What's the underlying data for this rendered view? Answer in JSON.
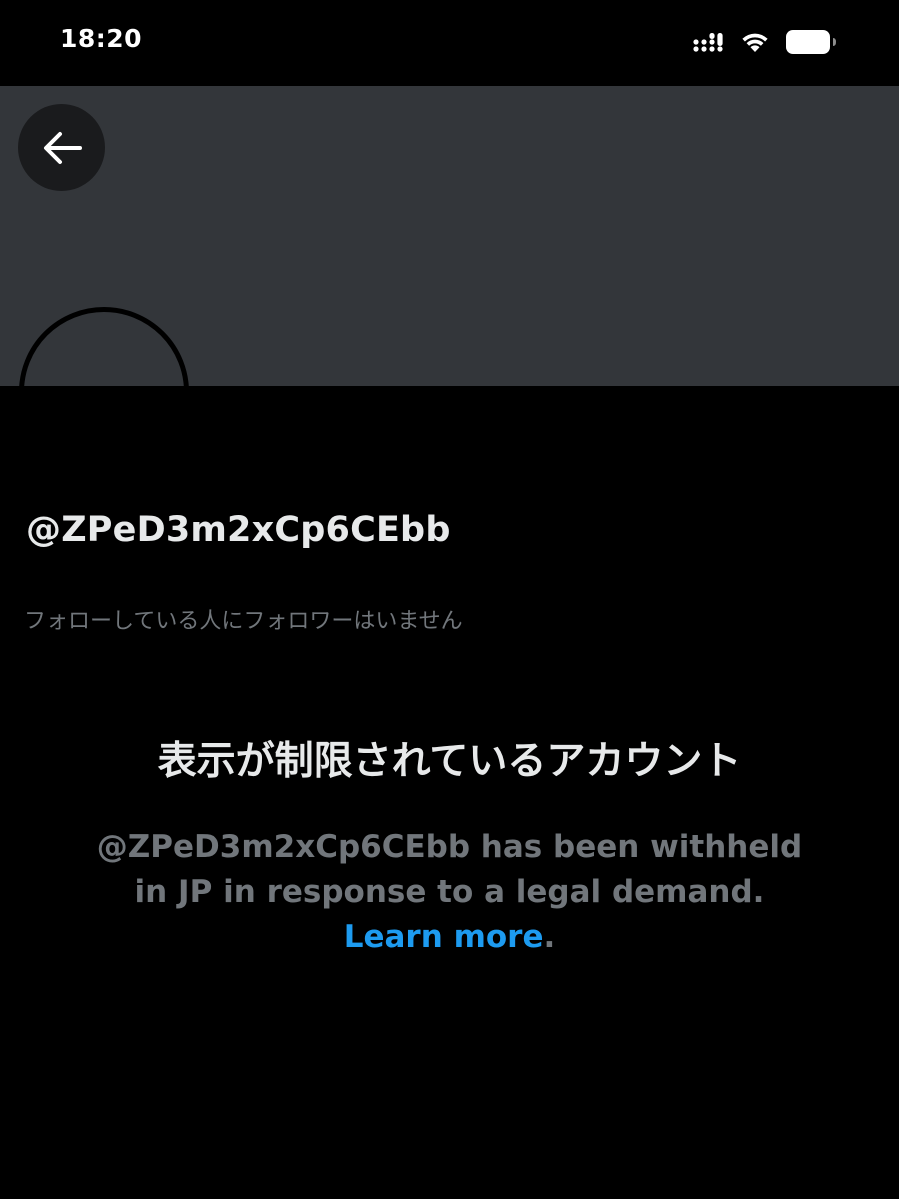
{
  "status_bar": {
    "time": "18:20",
    "icons": [
      "signal-icon",
      "wifi-icon",
      "battery-icon"
    ]
  },
  "header": {
    "back_icon": "back-arrow-icon"
  },
  "profile": {
    "handle": "@ZPeD3m2xCp6CEbb",
    "follow_note": "フォローしている人にフォロワーはいません"
  },
  "notice": {
    "title": "表示が制限されているアカウント",
    "body_text": "@ZPeD3m2xCp6CEbb has been withheld in JP in response to a legal demand. ",
    "link_text": "Learn more",
    "trailing": "."
  },
  "colors": {
    "background": "#000000",
    "banner": "#33363a",
    "primary_text": "#e7e9ea",
    "secondary_text": "#71767b",
    "link": "#1d9bf0"
  }
}
